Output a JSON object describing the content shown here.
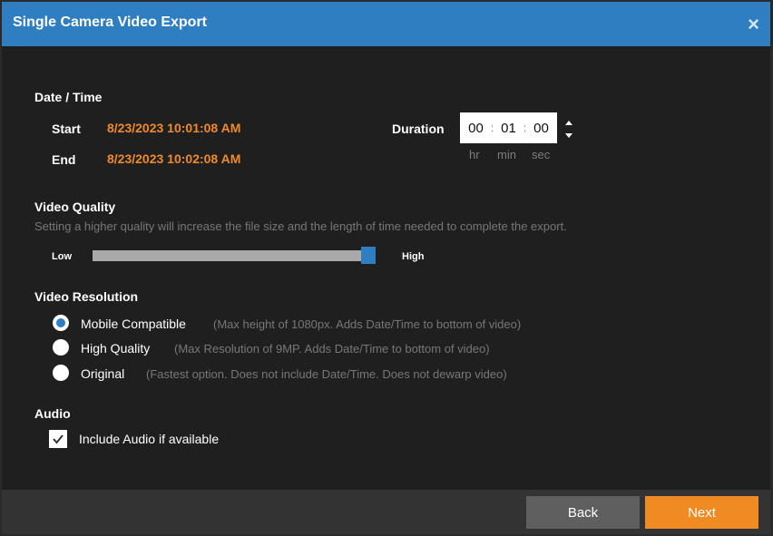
{
  "dialog": {
    "title": "Single Camera Video Export",
    "close_glyph": "×"
  },
  "datetime": {
    "section_title": "Date / Time",
    "start_label": "Start",
    "start_value": "8/23/2023 10:01:08 AM",
    "end_label": "End",
    "end_value": "8/23/2023 10:02:08 AM",
    "duration_label": "Duration",
    "duration": {
      "hr": "00",
      "min": "01",
      "sec": "00"
    },
    "units": {
      "hr": "hr",
      "min": "min",
      "sec": "sec"
    }
  },
  "quality": {
    "section_title": "Video Quality",
    "description": "Setting a higher quality will increase the file size and the length of time needed to complete the export.",
    "low_label": "Low",
    "high_label": "High",
    "level_percent": 98
  },
  "resolution": {
    "section_title": "Video Resolution",
    "options": [
      {
        "label": "Mobile Compatible",
        "hint": "(Max height of 1080px. Adds Date/Time to bottom of video)",
        "selected": true
      },
      {
        "label": "High Quality",
        "hint": "(Max Resolution of 9MP. Adds Date/Time to bottom of video)",
        "selected": false
      },
      {
        "label": "Original",
        "hint": "(Fastest option. Does not include Date/Time. Does not dewarp video)",
        "selected": false
      }
    ]
  },
  "audio": {
    "section_title": "Audio",
    "include_label": "Include Audio if available",
    "checked": true
  },
  "footer": {
    "back_label": "Back",
    "next_label": "Next"
  },
  "colors": {
    "accent_blue": "#2f7ec2",
    "accent_orange": "#f08a22",
    "date_orange": "#ef8a2a"
  }
}
